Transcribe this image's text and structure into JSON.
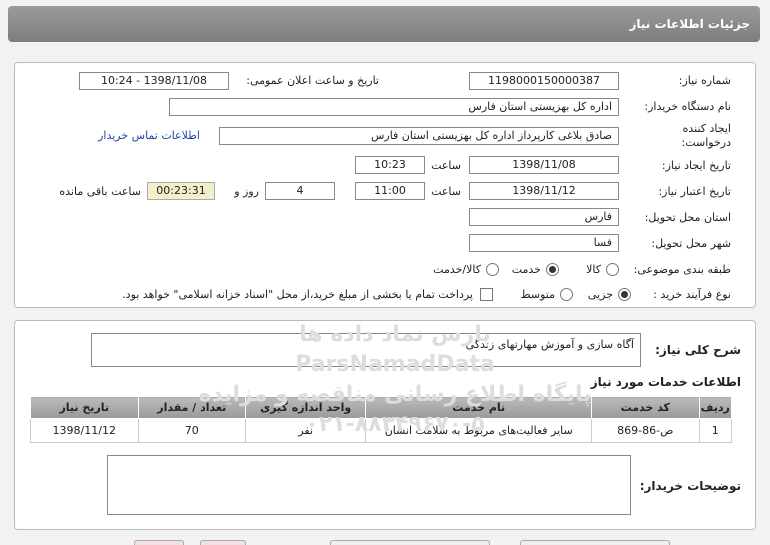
{
  "header": {
    "title": "جزئیات اطلاعات نیاز"
  },
  "form": {
    "need_number_label": "شماره نیاز:",
    "need_number": "1198000150000387",
    "announce_label": "تاریخ و ساعت اعلان عمومی:",
    "announce_value": "1398/11/08 - 10:24",
    "buyer_org_label": "نام دستگاه خریدار:",
    "buyer_org": "اداره کل بهزیستی استان فارس",
    "creator_label_1": "ایجاد کننده",
    "creator_label_2": "درخواست:",
    "creator": "صادق  بلاغی کارپرداز اداره کل بهزیستی استان فارس",
    "contact_link": "اطلاعات تماس خریدار",
    "created_date_label": "تاریخ ایجاد نیاز:",
    "created_date": "1398/11/08",
    "time_label": "ساعت",
    "created_time": "10:23",
    "validity_label": "تاریخ اعتبار نیاز:",
    "validity_date": "1398/11/12",
    "validity_time": "11:00",
    "days_value": "4",
    "days_label": "روز و",
    "remaining_time": "00:23:31",
    "remaining_label": "ساعت باقی مانده",
    "province_label": "استان محل تحویل:",
    "province": "فارس",
    "city_label": "شهر محل تحویل:",
    "city": "فسا",
    "category_label": "طبقه بندی موضوعی:",
    "category_options": [
      "کالا",
      "خدمت",
      "کالا/خدمت"
    ],
    "process_label": "نوع فرآیند خرید :",
    "process_options": [
      "جزیی",
      "متوسط"
    ],
    "payment_note": "پرداخت تمام یا بخشی از مبلغ خرید،از محل \"اسناد خزانه اسلامی\" خواهد بود."
  },
  "description": {
    "label": "شرح کلی نیاز:",
    "value": "آگاه سازی و آموزش مهارتهای زندگی"
  },
  "services": {
    "title": "اطلاعات خدمات مورد نیاز",
    "columns": [
      "ردیف",
      "کد خدمت",
      "نام خدمت",
      "واحد اندازه گیری",
      "تعداد / مقدار",
      "تاریخ نیاز"
    ],
    "rows": [
      [
        "1",
        "ص-86-869",
        "سایر فعالیت‌های مربوط به سلامت انسان",
        "نفر",
        "70",
        "1398/11/12"
      ]
    ]
  },
  "buyer_notes": {
    "label": "توضیحات خریدار:"
  },
  "watermark": {
    "line1": "پارس نماد داده ها",
    "line2": "ParsNamadData",
    "line3": "پایگاه اطلاع رسانی مناقصه و مزایده",
    "line4": "۰۲۱-۸۸۳۴۹۶۷۰-۵"
  }
}
